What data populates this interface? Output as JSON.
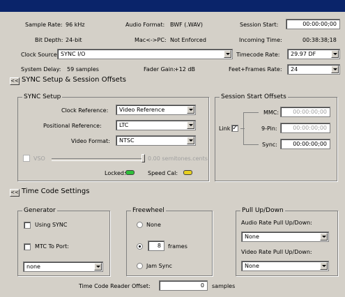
{
  "top": {
    "sample_rate_label": "Sample Rate:",
    "sample_rate_value": "96 kHz",
    "bit_depth_label": "Bit Depth:",
    "bit_depth_value": "24-bit",
    "audio_format_label": "Audio Format:",
    "audio_format_value": "BWF (.WAV)",
    "mac_pc_label": "Mac<->PC:",
    "mac_pc_value": "Not Enforced",
    "session_start_label": "Session Start:",
    "session_start_value": "00:00:00;00",
    "incoming_time_label": "Incoming Time:",
    "incoming_time_value": "00:38:38;18",
    "clock_source_label": "Clock Source:",
    "clock_source_value": "SYNC I/O",
    "timecode_rate_label": "Timecode Rate:",
    "timecode_rate_value": "29.97 DF",
    "system_delay_label": "System Delay:",
    "system_delay_value": "59 samples",
    "fader_gain_label": "Fader Gain:",
    "fader_gain_value": "+12 dB",
    "feet_frames_label": "Feet+Frames Rate:",
    "feet_frames_value": "24"
  },
  "sync_section": {
    "toggle": "<<",
    "title": "SYNC Setup & Session Offsets",
    "sync_setup": {
      "title": "SYNC Setup",
      "clock_reference_label": "Clock Reference:",
      "clock_reference_value": "Video Reference",
      "positional_reference_label": "Positional Reference:",
      "positional_reference_value": "LTC",
      "video_format_label": "Video Format:",
      "video_format_value": "NTSC",
      "vso_label": "VSO",
      "vso_value": "0.00 semitones.cents",
      "locked_label": "Locked:",
      "speed_cal_label": "Speed Cal:"
    },
    "offsets": {
      "title": "Session Start Offsets",
      "mmc_label": "MMC:",
      "mmc_value": "00:00:00;00",
      "link_label": "Link",
      "link_check": "✓",
      "nine_pin_label": "9-Pin:",
      "nine_pin_value": "00:00:00;00",
      "sync_label": "Sync:",
      "sync_value": "00:00:00;00"
    }
  },
  "timecode_section": {
    "toggle": "<<",
    "title": "Time Code Settings",
    "generator": {
      "title": "Generator",
      "using_sync_label": "Using SYNC",
      "mtc_label": "MTC To Port:",
      "port_value": "none"
    },
    "freewheel": {
      "title": "Freewheel",
      "none_label": "None",
      "frames_value": "8",
      "frames_label": "frames",
      "jam_sync_label": "Jam Sync"
    },
    "pulldown": {
      "title": "Pull Up/Down",
      "audio_label": "Audio Rate Pull Up/Down:",
      "audio_value": "None",
      "video_label": "Video Rate Pull Up/Down:",
      "video_value": "None"
    },
    "reader_offset_label": "Time Code Reader Offset:",
    "reader_offset_value": "0",
    "reader_offset_unit": "samples"
  },
  "colors": {
    "title_bar": "#0a246a",
    "locked_led": "#2fbf3a",
    "speed_cal_led": "#e8d020"
  }
}
